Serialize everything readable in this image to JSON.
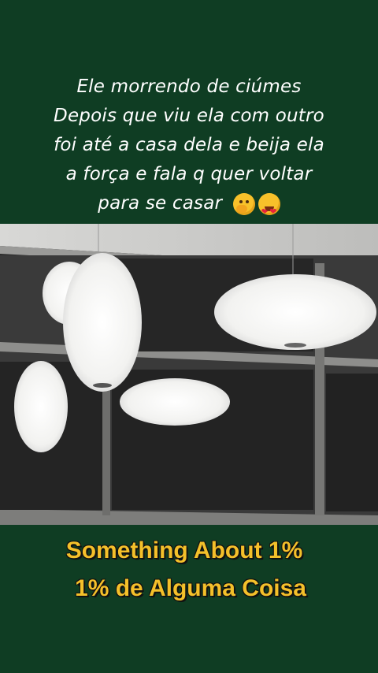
{
  "caption": {
    "lines": [
      "Ele morrendo de ciúmes",
      "Depois que viu ela com outro",
      "foi até a casa dela e beija ela",
      "a força e fala q quer voltar",
      "para se casar"
    ],
    "emojis": [
      "face-with-hand-over-mouth-icon",
      "heart-eyes-icon"
    ]
  },
  "photo": {
    "subject": "pendant-lamps-scene"
  },
  "titles": {
    "english": "Something About 1%",
    "portuguese": "1% de Alguma Coisa"
  },
  "colors": {
    "background": "#0f3d23",
    "title": "#f4c02a",
    "caption": "#ffffff"
  }
}
